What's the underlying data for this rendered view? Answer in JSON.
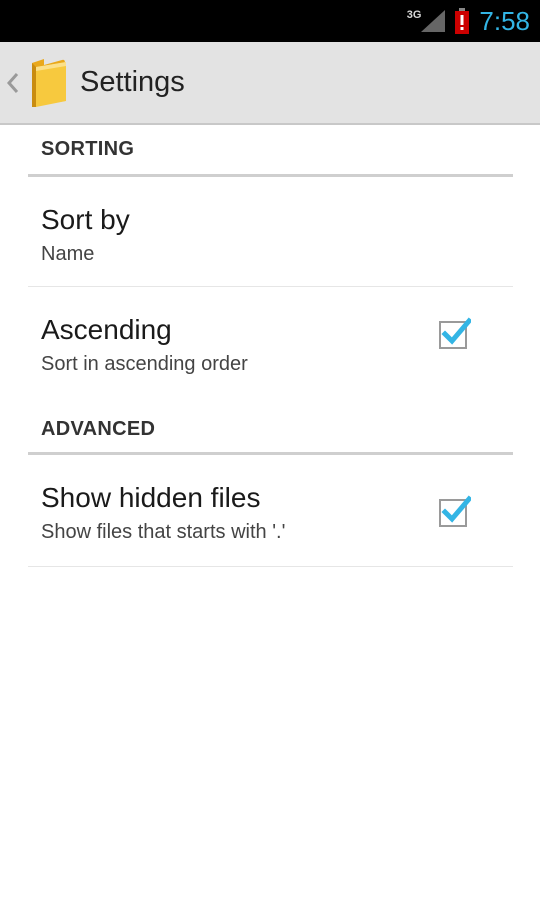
{
  "status_bar": {
    "network_type": "3G",
    "time": "7:58",
    "icons": [
      "signal-icon",
      "battery-alert-icon"
    ]
  },
  "action_bar": {
    "title": "Settings",
    "icons": [
      "up-caret-icon",
      "folder-icon"
    ]
  },
  "sections": [
    {
      "header": "SORTING",
      "items": [
        {
          "title": "Sort by",
          "summary": "Name",
          "type": "list"
        },
        {
          "title": "Ascending",
          "summary": "Sort in ascending order",
          "type": "checkbox",
          "checked": true
        }
      ]
    },
    {
      "header": "ADVANCED",
      "items": [
        {
          "title": "Show hidden files",
          "summary": "Show files that starts with '.'",
          "type": "checkbox",
          "checked": true
        }
      ]
    }
  ],
  "colors": {
    "status_bar_bg": "#000000",
    "clock": "#33b5e5",
    "action_bar_bg": "#e3e3e3",
    "checkbox_check": "#33b5e5",
    "folder": "#f5c030"
  }
}
